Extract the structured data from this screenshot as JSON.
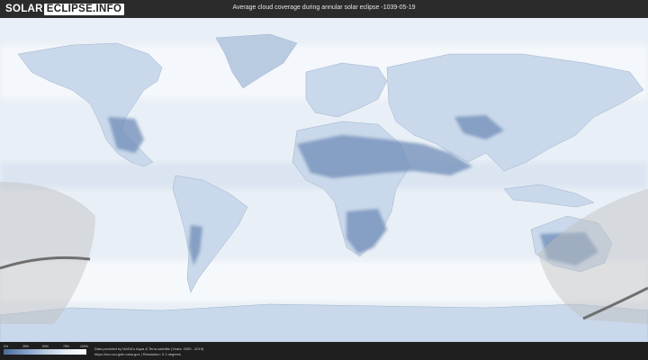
{
  "header": {
    "logo_part1": "SOLAR",
    "logo_part2": "ECLIPSE.INFO",
    "title": "Average cloud coverage during annular solar eclipse -1039-05-19"
  },
  "legend": {
    "ticks": [
      "0%",
      "25%",
      "50%",
      "75%",
      "100%"
    ],
    "colors": [
      "#4a6a9a",
      "#7f9cc4",
      "#b8cbe2",
      "#e6edf6",
      "#ffffff"
    ]
  },
  "footer": {
    "credit_line1": "Data provided by NASA's Aqua & Terra satellite (Years: 2000 - 2019)",
    "credit_line2": "https://neo.sci.gsfc.nasa.gov | Resolution: 0.1 degrees"
  },
  "map": {
    "ocean_color": "#e9eff6",
    "land_cloudy_color": "#c9d8ea",
    "land_clear_color": "#6f8db8",
    "eclipse_path_color": "#6f6f6f"
  }
}
